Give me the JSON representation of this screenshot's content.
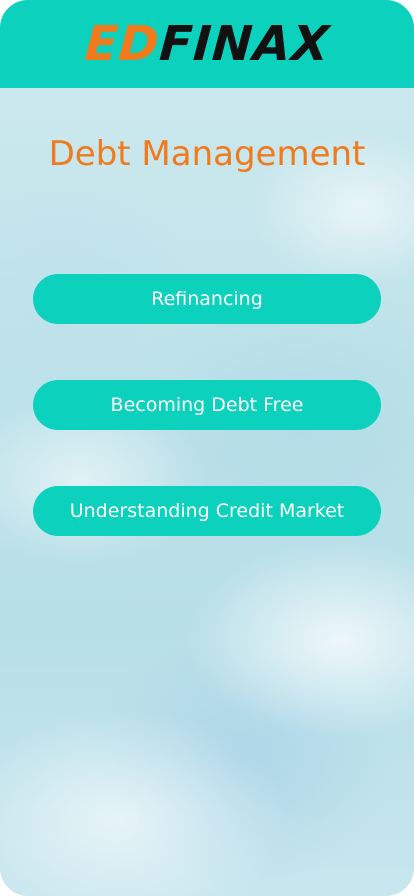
{
  "header": {
    "logo_part1": "ED",
    "logo_part2": "FINAX",
    "background_color": "#0bd1bd",
    "logo_accent_color": "#f07a1c"
  },
  "page": {
    "title": "Debt Management",
    "title_color": "#f07a1c"
  },
  "menu": {
    "items": [
      {
        "label": "Refinancing"
      },
      {
        "label": "Becoming Debt Free"
      },
      {
        "label": "Understanding Credit Market"
      }
    ],
    "button_color": "#0bd1bd"
  }
}
